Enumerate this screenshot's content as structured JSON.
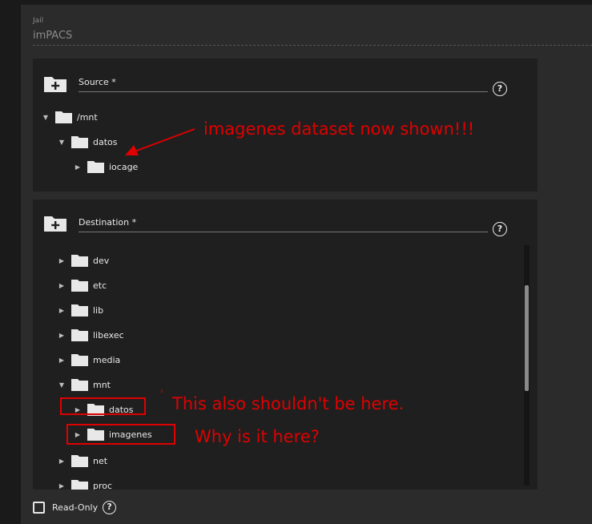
{
  "jail": {
    "label": "Jail",
    "value": "imPACS"
  },
  "source": {
    "label": "Source *",
    "tree": [
      {
        "label": "/mnt",
        "expanded": true
      },
      {
        "label": "datos",
        "expanded": true
      },
      {
        "label": "iocage",
        "expanded": false
      }
    ]
  },
  "destination": {
    "label": "Destination *",
    "tree": [
      {
        "label": "dev",
        "expanded": false
      },
      {
        "label": "etc",
        "expanded": false
      },
      {
        "label": "lib",
        "expanded": false
      },
      {
        "label": "libexec",
        "expanded": false
      },
      {
        "label": "media",
        "expanded": false
      },
      {
        "label": "mnt",
        "expanded": true
      },
      {
        "label": "datos",
        "expanded": false
      },
      {
        "label": "imagenes",
        "expanded": false
      },
      {
        "label": "net",
        "expanded": false
      },
      {
        "label": "proc",
        "expanded": false
      }
    ]
  },
  "readonly": {
    "label": "Read-Only",
    "checked": false
  },
  "annotations": {
    "source_note": "imagenes dataset now shown!!!",
    "datos_note": "This also shouldn't be here.",
    "imagenes_note": "Why is it here?",
    "tick": "'"
  },
  "icons": {
    "help": "?"
  },
  "colors": {
    "annotation": "#e00000",
    "panel": "#1f1f1f",
    "card": "#2b2b2b"
  }
}
